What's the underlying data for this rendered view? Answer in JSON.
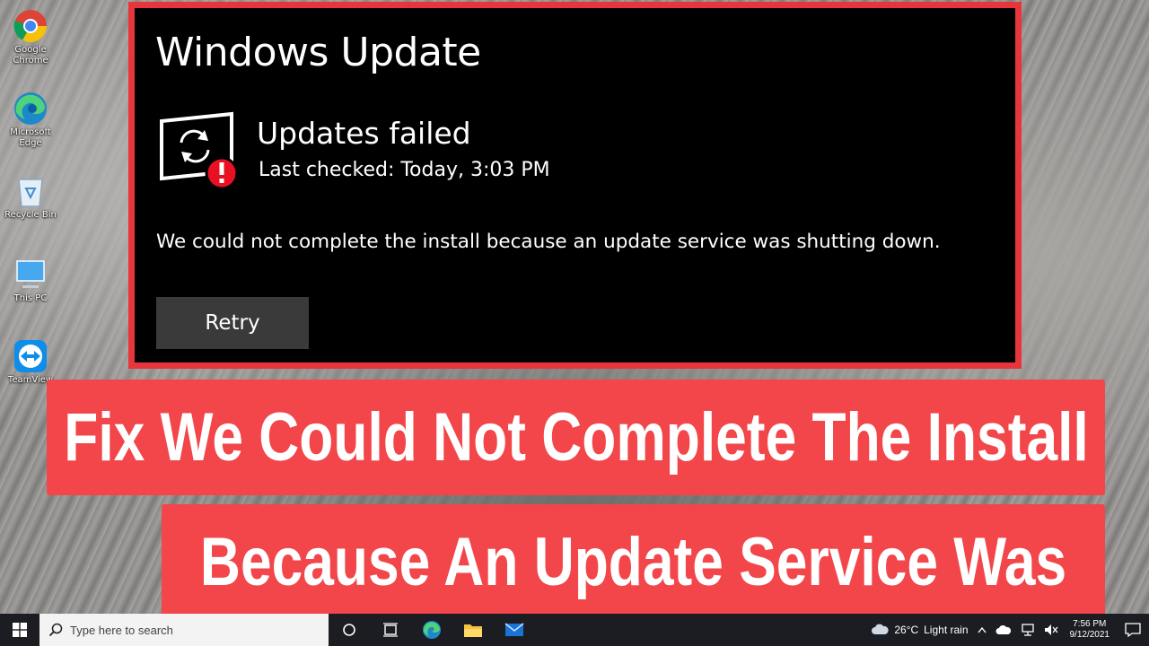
{
  "desktop": {
    "icons": [
      {
        "label": "Google Chrome",
        "icon": "chrome-icon"
      },
      {
        "label": "Microsoft Edge",
        "icon": "edge-icon"
      },
      {
        "label": "Recycle Bin",
        "icon": "recycle-bin-icon"
      },
      {
        "label": "This PC",
        "icon": "computer-icon"
      },
      {
        "label": "TeamView",
        "icon": "teamviewer-icon"
      }
    ]
  },
  "windows_update": {
    "title": "Windows Update",
    "status_title": "Updates failed",
    "last_checked": "Last checked: Today, 3:03 PM",
    "error_message": "We could not complete the install because an update service was shutting down.",
    "retry_label": "Retry"
  },
  "captions": {
    "line1": "Fix We Could Not Complete The Install",
    "line2": "Because An Update Service Was"
  },
  "taskbar": {
    "search_placeholder": "Type here to search",
    "weather_temp": "26°C",
    "weather_desc": "Light rain",
    "time": "7:56 PM",
    "date": "9/12/2021"
  },
  "colors": {
    "accent_red": "#e8343b",
    "caption_red": "#f2464a",
    "panel_bg": "#000000",
    "button_bg": "#3a3a3a",
    "taskbar_bg": "#1c1d22"
  }
}
